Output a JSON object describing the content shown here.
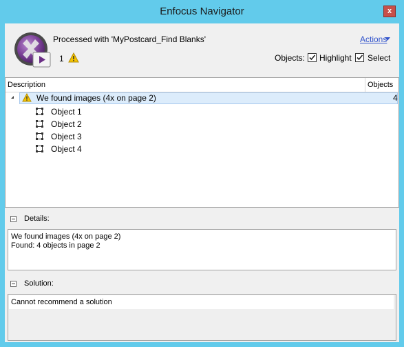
{
  "window": {
    "title": "Enfocus Navigator",
    "close_label": "x"
  },
  "header": {
    "processed_text": "Processed with 'MyPostcard_Find Blanks'",
    "warning_count": "1",
    "actions_label": "Actions",
    "objects_label": "Objects:",
    "highlight_label": "Highlight",
    "highlight_checked": true,
    "select_label": "Select",
    "select_checked": true
  },
  "tree": {
    "columns": [
      "Description",
      "Objects"
    ],
    "group": {
      "text": "We found images (4x on page 2)",
      "count": "4"
    },
    "objects": [
      "Object 1",
      "Object 2",
      "Object 3",
      "Object 4"
    ]
  },
  "details": {
    "label": "Details:",
    "lines": [
      "We found images (4x on page 2)",
      "Found: 4 objects in page 2"
    ]
  },
  "solution": {
    "label": "Solution:",
    "text": "Cannot recommend a solution"
  },
  "colors": {
    "titlebar": "#62cbeb",
    "client": "#f0f0f0",
    "selection": "#dcecfb",
    "link": "#3355cc",
    "close": "#c7504a"
  }
}
